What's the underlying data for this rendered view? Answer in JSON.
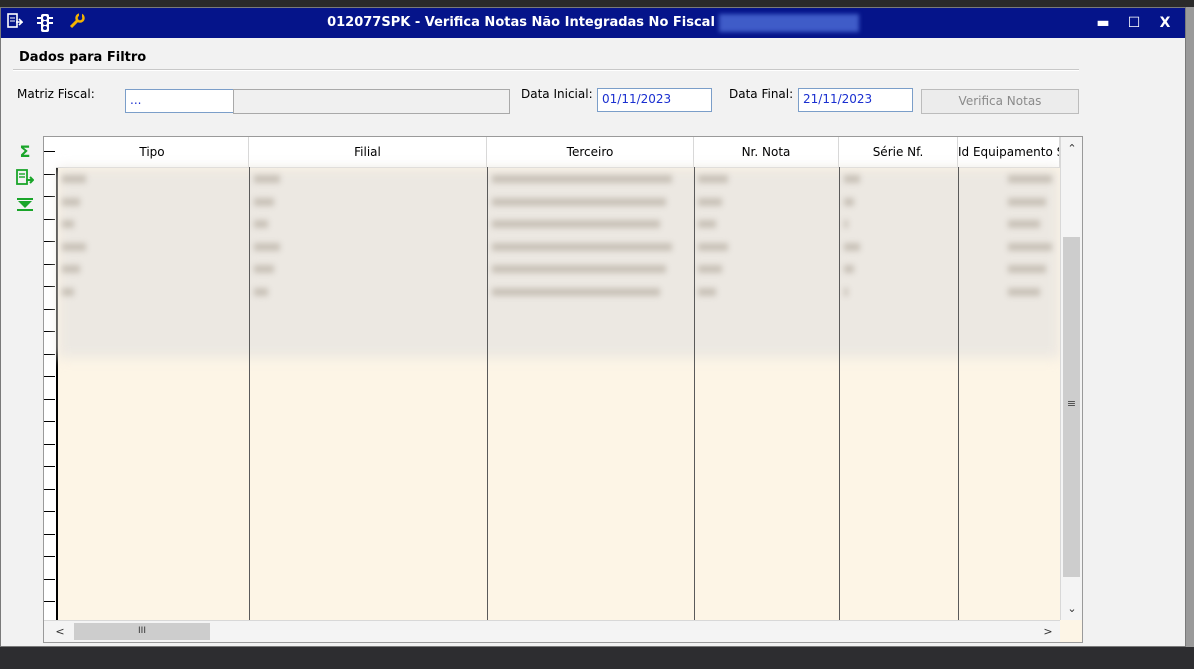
{
  "window": {
    "title": "012077SPK - Verifica Notas Não Integradas No Fiscal",
    "icons": [
      "menu-icon",
      "traffic-light-icon",
      "wrench-icon"
    ],
    "controls": {
      "minimize": "▬",
      "maximize": "☐",
      "close": "X"
    }
  },
  "filter": {
    "group_title": "Dados para Filtro",
    "matriz_label": "Matriz Fiscal:",
    "matriz_value": "...",
    "data_inicial_label": "Data Inicial:",
    "data_inicial_value": "01/11/2023",
    "data_final_label": "Data Final:",
    "data_final_value": "21/11/2023",
    "verifica_button": "Verifica Notas"
  },
  "side_toolbar": {
    "sum_icon": "Σ",
    "export_icon": "⇨",
    "expand_icon": "⏬"
  },
  "grid": {
    "columns": [
      "Tipo",
      "Filial",
      "Terceiro",
      "Nr. Nota",
      "Série Nf.",
      "Id Equipamento S"
    ],
    "visible_rows_obscured": 6,
    "scroll": {
      "up": "⌃",
      "down": "⌄",
      "left": "<",
      "right": ">",
      "grip": "≡",
      "hgrip": "III"
    }
  },
  "colors": {
    "titlebar": "#05148a",
    "grid_bg": "#fdf5e6",
    "field_text": "#1a2fd0",
    "icon_green": "#1aa52a"
  }
}
